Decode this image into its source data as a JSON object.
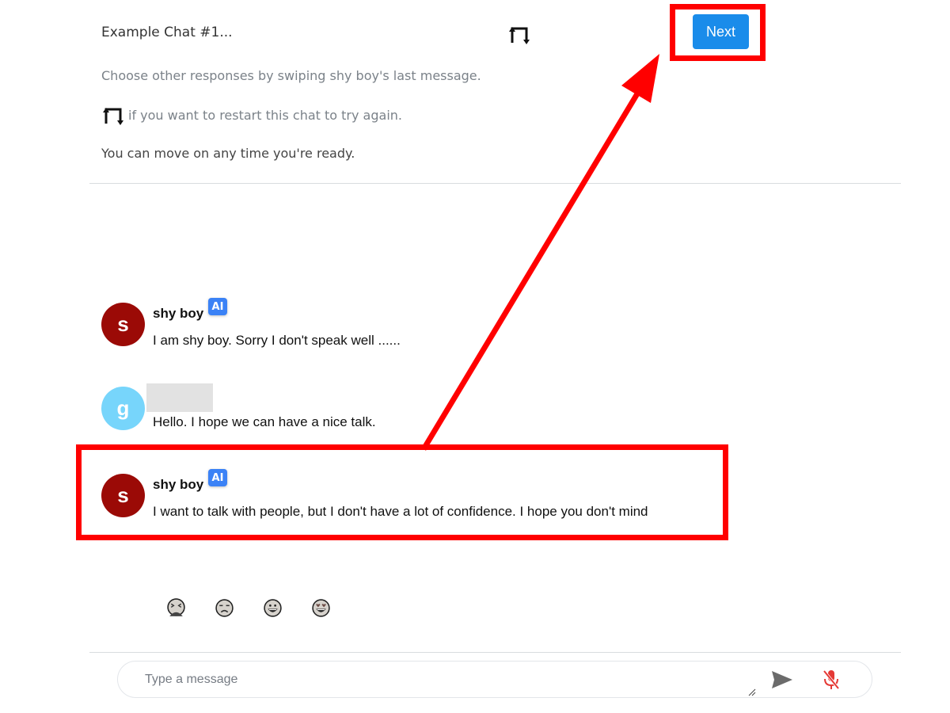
{
  "header": {
    "title": "Example Chat #1...",
    "restart_icon": "restart-icon",
    "next_label": "Next"
  },
  "instructions": {
    "line1": "Choose other responses by swiping shy boy's last message.",
    "line2": "if you want to restart this chat to try again.",
    "line3": "You can move on any time you're ready."
  },
  "messages": [
    {
      "sender": "shy boy",
      "avatar_letter": "s",
      "avatar_color": "#9b0a06",
      "badge": "AI",
      "text": "I am shy boy.  Sorry I don't speak well ......"
    },
    {
      "sender": "",
      "avatar_letter": "g",
      "avatar_color": "#77d5fb",
      "badge": null,
      "text": "Hello. I hope we can have a nice talk."
    },
    {
      "sender": "shy boy",
      "avatar_letter": "s",
      "avatar_color": "#9b0a06",
      "badge": "AI",
      "text": "I want to talk with people, but I don't have a lot of confidence.  I hope you don't mind"
    }
  ],
  "reactions": [
    {
      "name": "nauseated-face-icon"
    },
    {
      "name": "unamused-face-icon"
    },
    {
      "name": "grinning-face-icon"
    },
    {
      "name": "heart-eyes-face-icon"
    }
  ],
  "composer": {
    "placeholder": "Type a message",
    "value": "",
    "send_icon": "send-icon",
    "mic_icon": "mic-off-icon"
  },
  "colors": {
    "accent": "#1a8cea",
    "annotation": "#ff0000",
    "mic_muted": "#e53935",
    "ai_badge": "#3b82f6"
  }
}
